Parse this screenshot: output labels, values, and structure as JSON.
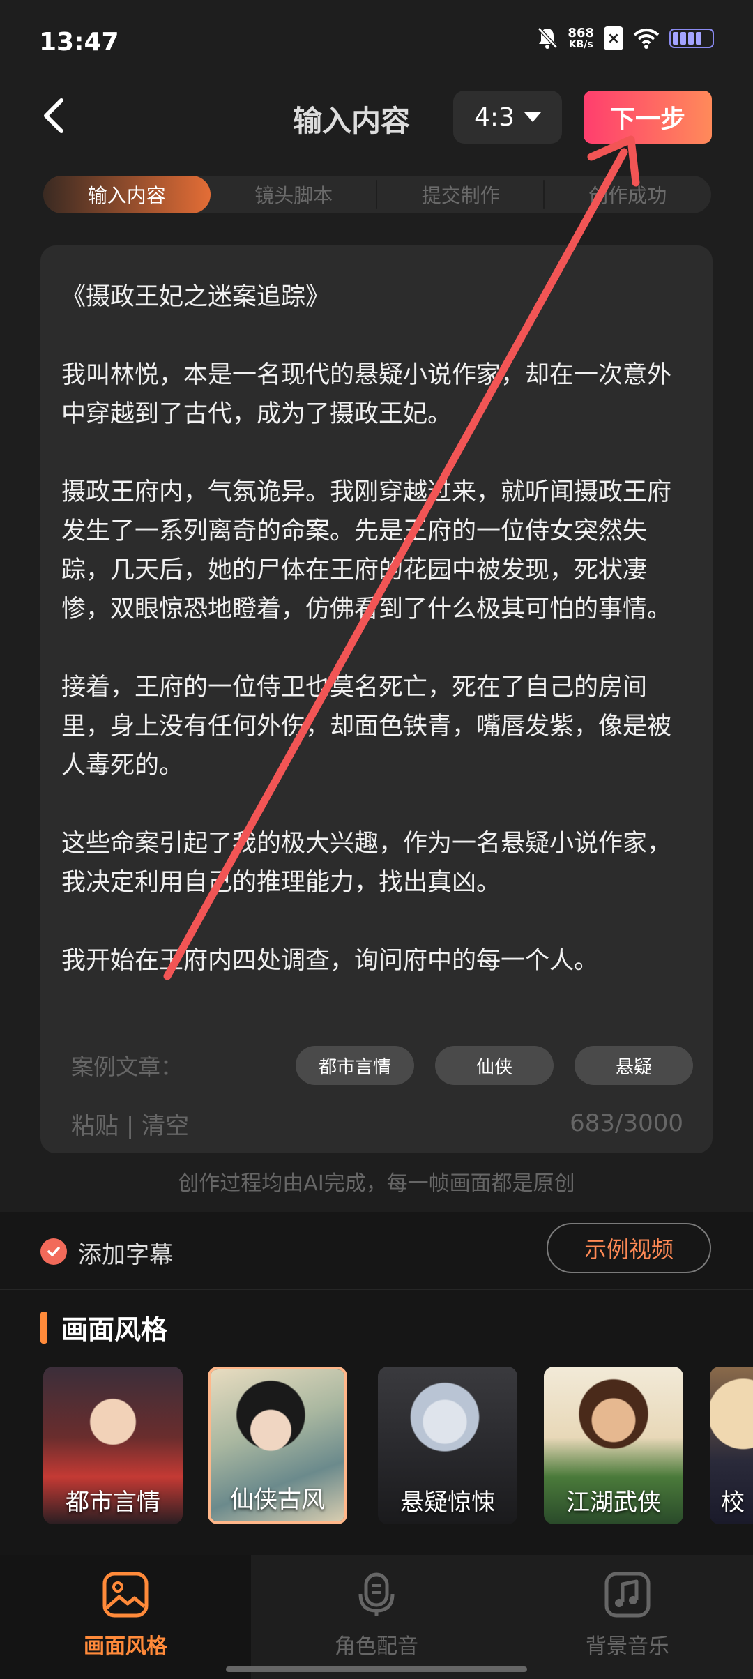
{
  "status": {
    "time": "13:47",
    "net_speed_value": "868",
    "net_speed_unit": "KB/s"
  },
  "header": {
    "title": "输入内容",
    "ratio": "4:3",
    "next_label": "下一步"
  },
  "steps": [
    "输入内容",
    "镜头脚本",
    "提交制作",
    "创作成功"
  ],
  "story": {
    "title": "《摄政王妃之迷案追踪》",
    "paragraphs": [
      "我叫林悦，本是一名现代的悬疑小说作家，却在一次意外中穿越到了古代，成为了摄政王妃。",
      "摄政王府内，气氛诡异。我刚穿越过来，就听闻摄政王府发生了一系列离奇的命案。先是王府的一位侍女突然失踪，几天后，她的尸体在王府的花园中被发现，死状凄惨，双眼惊恐地瞪着，仿佛看到了什么极其可怕的事情。",
      "接着，王府的一位侍卫也莫名死亡，死在了自己的房间里，身上没有任何外伤，却面色铁青，嘴唇发紫，像是被人毒死的。",
      "这些命案引起了我的极大兴趣，作为一名悬疑小说作家，我决定利用自己的推理能力，找出真凶。",
      "我开始在王府内四处调查，询问府中的每一个人。"
    ]
  },
  "examples": {
    "label": "案例文章：",
    "chips": [
      "都市言情",
      "仙侠",
      "悬疑"
    ]
  },
  "actions": {
    "paste": "粘贴",
    "divider": "|",
    "clear": "清空",
    "count": "683/3000"
  },
  "notice": "创作过程均由AI完成，每一帧画面都是原创",
  "subtitle": {
    "label": "添加字幕",
    "checked": true,
    "example_video": "示例视频"
  },
  "style_section": {
    "title": "画面风格",
    "items": [
      {
        "name": "都市言情",
        "selected": false
      },
      {
        "name": "仙侠古风",
        "selected": true
      },
      {
        "name": "悬疑惊悚",
        "selected": false
      },
      {
        "name": "江湖武侠",
        "selected": false
      },
      {
        "name": "校",
        "selected": false
      }
    ]
  },
  "tabs": [
    {
      "label": "画面风格",
      "icon": "image-icon",
      "active": true
    },
    {
      "label": "角色配音",
      "icon": "microphone-icon",
      "active": false
    },
    {
      "label": "背景音乐",
      "icon": "music-icon",
      "active": false
    }
  ],
  "colors": {
    "accent": "#ff8a3a",
    "next_gradient_start": "#ff3e6e",
    "next_gradient_end": "#ff8a5a",
    "annotation_arrow": "#f25555"
  }
}
